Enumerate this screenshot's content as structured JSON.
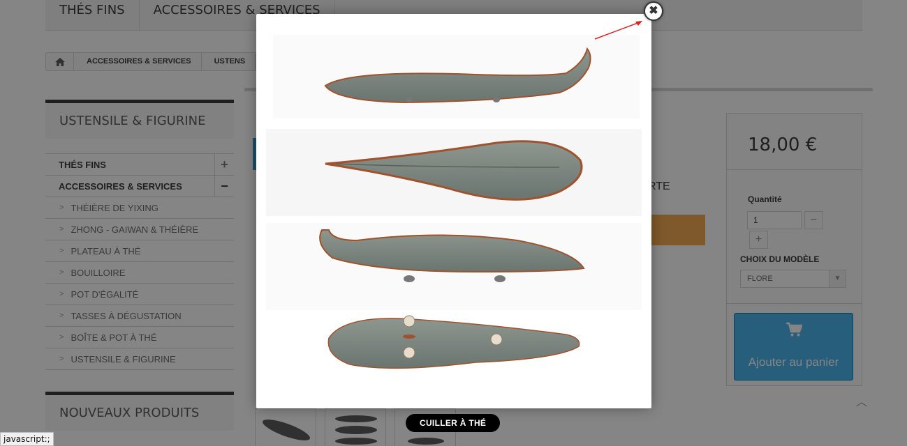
{
  "topnav": {
    "items": [
      "THÉS FINS",
      "ACCESSOIRES & SERVICES"
    ]
  },
  "breadcrumb": {
    "items": [
      "ACCESSOIRES & SERVICES",
      "USTENS"
    ]
  },
  "category_block": {
    "title": "USTENSILE & FIGURINE",
    "top_items": [
      {
        "label": "THÉS FINS",
        "toggle": "+"
      },
      {
        "label": "ACCESSOIRES & SERVICES",
        "toggle": "−"
      }
    ],
    "sub_items": [
      "THÉIÈRE DE YIXING",
      "ZHONG - GAIWAN & THÉIÈRE",
      "PLATEAU À THÉ",
      "BOUILLOIRE",
      "POT D'ÉGALITÉ",
      "TASSES À DÉGUSTATION",
      "BOÎTE & POT À THÉ",
      "USTENSILE & FIGURINE"
    ]
  },
  "new_products": {
    "title": "NOUVEAUX PRODUITS"
  },
  "product": {
    "partial_text": "RTE"
  },
  "buy_box": {
    "price": "18,00 €",
    "quantity_label": "Quantité",
    "quantity_value": "1",
    "qty_minus": "−",
    "qty_plus": "+",
    "model_label": "CHOIX DU MODÈLE",
    "model_value": "FLORE",
    "add_to_cart": "Ajouter au panier"
  },
  "lightbox": {
    "caption": "CUILLER À THÉ",
    "close_symbol": "✖"
  },
  "status_bar": "javascript:;",
  "colors": {
    "accent_blue": "#43b0ec",
    "orange": "#f3a54a",
    "spoon_glaze": "#7f8a82",
    "spoon_rim": "#a0522d"
  }
}
